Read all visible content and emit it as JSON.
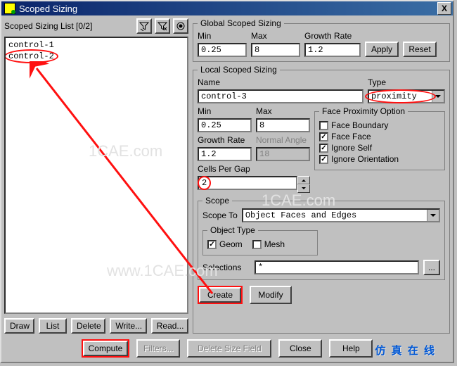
{
  "window": {
    "title": "Scoped Sizing",
    "close": "X"
  },
  "left": {
    "list_label": "Scoped Sizing List [0/2]",
    "items": [
      "control-1",
      "control-2"
    ],
    "buttons": {
      "draw": "Draw",
      "list": "List",
      "delete": "Delete",
      "write": "Write...",
      "read": "Read..."
    }
  },
  "global": {
    "legend": "Global Scoped Sizing",
    "min_label": "Min",
    "min": "0.25",
    "max_label": "Max",
    "max": "8",
    "growth_label": "Growth Rate",
    "growth": "1.2",
    "apply": "Apply",
    "reset": "Reset"
  },
  "local": {
    "legend": "Local Scoped Sizing",
    "name_label": "Name",
    "name": "control-3",
    "type_label": "Type",
    "type": "proximity",
    "min_label": "Min",
    "min": "0.25",
    "max_label": "Max",
    "max": "8",
    "growth_label": "Growth Rate",
    "growth": "1.2",
    "normal_label": "Normal Angle",
    "normal": "18",
    "cells_label": "Cells Per Gap",
    "cells": "2",
    "face_opt": {
      "legend": "Face Proximity Option",
      "fb": "Face Boundary",
      "fb_on": false,
      "ff": "Face Face",
      "ff_on": true,
      "is": "Ignore Self",
      "is_on": true,
      "io": "Ignore Orientation",
      "io_on": true
    },
    "scope": {
      "legend": "Scope",
      "scope_to_label": "Scope To",
      "scope_to": "Object Faces and Edges",
      "object_type_legend": "Object Type",
      "geom": "Geom",
      "geom_on": true,
      "mesh": "Mesh",
      "mesh_on": false,
      "selections_label": "Selections",
      "selections": "*"
    },
    "create": "Create",
    "modify": "Modify"
  },
  "footer": {
    "compute": "Compute",
    "filters": "Filters...",
    "delete_sf": "Delete Size Field",
    "close": "Close",
    "help": "Help"
  },
  "caption": "仿 真 在 线",
  "watermark_url": "1CAE.com",
  "watermark_site": "www.1CAE.com"
}
